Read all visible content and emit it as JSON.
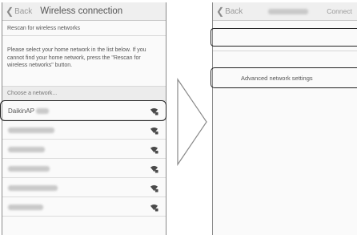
{
  "left_screen": {
    "back_label": "Back",
    "title": "Wireless connection",
    "rescan_label": "Rescan for wireless networks",
    "instructions": "Please select your home network in the list below. If you cannot find your home network, press the \"Rescan for wireless networks\" button.",
    "choose_header": "Choose a network...",
    "networks": [
      {
        "name": "DaikinAP"
      },
      {
        "name": ""
      },
      {
        "name": ""
      },
      {
        "name": ""
      },
      {
        "name": ""
      },
      {
        "name": ""
      }
    ]
  },
  "right_screen": {
    "back_label": "Back",
    "connect_label": "Connect",
    "advanced_label": "Advanced network settings"
  },
  "icons": {
    "back": "chevron-left-icon",
    "wifi": "wifi-lock-icon",
    "arrow": "arrow-right-icon"
  }
}
